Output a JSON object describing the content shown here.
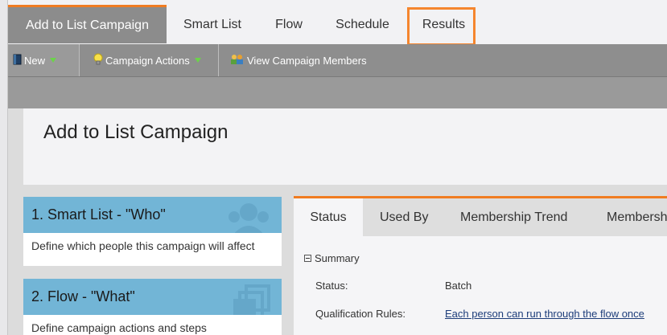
{
  "tabs": [
    {
      "label": "Add to List Campaign",
      "active": true
    },
    {
      "label": "Smart List",
      "active": false
    },
    {
      "label": "Flow",
      "active": false
    },
    {
      "label": "Schedule",
      "active": false
    },
    {
      "label": "Results",
      "active": false,
      "highlighted": true
    }
  ],
  "toolbar": {
    "new_label": "New",
    "campaign_actions_label": "Campaign Actions",
    "view_members_label": "View Campaign Members"
  },
  "page": {
    "title": "Add to List Campaign"
  },
  "cards": [
    {
      "title": "1. Smart List - \"Who\"",
      "description": "Define which people this campaign will affect",
      "icon": "people-icon"
    },
    {
      "title": "2. Flow - \"What\"",
      "description": "Define campaign actions and steps",
      "icon": "stack-icon"
    }
  ],
  "results_tabs": [
    {
      "label": "Status",
      "active": true
    },
    {
      "label": "Used By",
      "active": false
    },
    {
      "label": "Membership Trend",
      "active": false
    },
    {
      "label": "Membersh",
      "active": false
    }
  ],
  "summary": {
    "heading": "Summary",
    "status_label": "Status:",
    "status_value": "Batch",
    "qualification_label": "Qualification Rules:",
    "qualification_value": "Each person can run through the flow once"
  },
  "colors": {
    "accent": "#f07c21",
    "card_header": "#72b5d6",
    "toolbar": "#8e8e8e",
    "link": "#1d3d7a"
  }
}
